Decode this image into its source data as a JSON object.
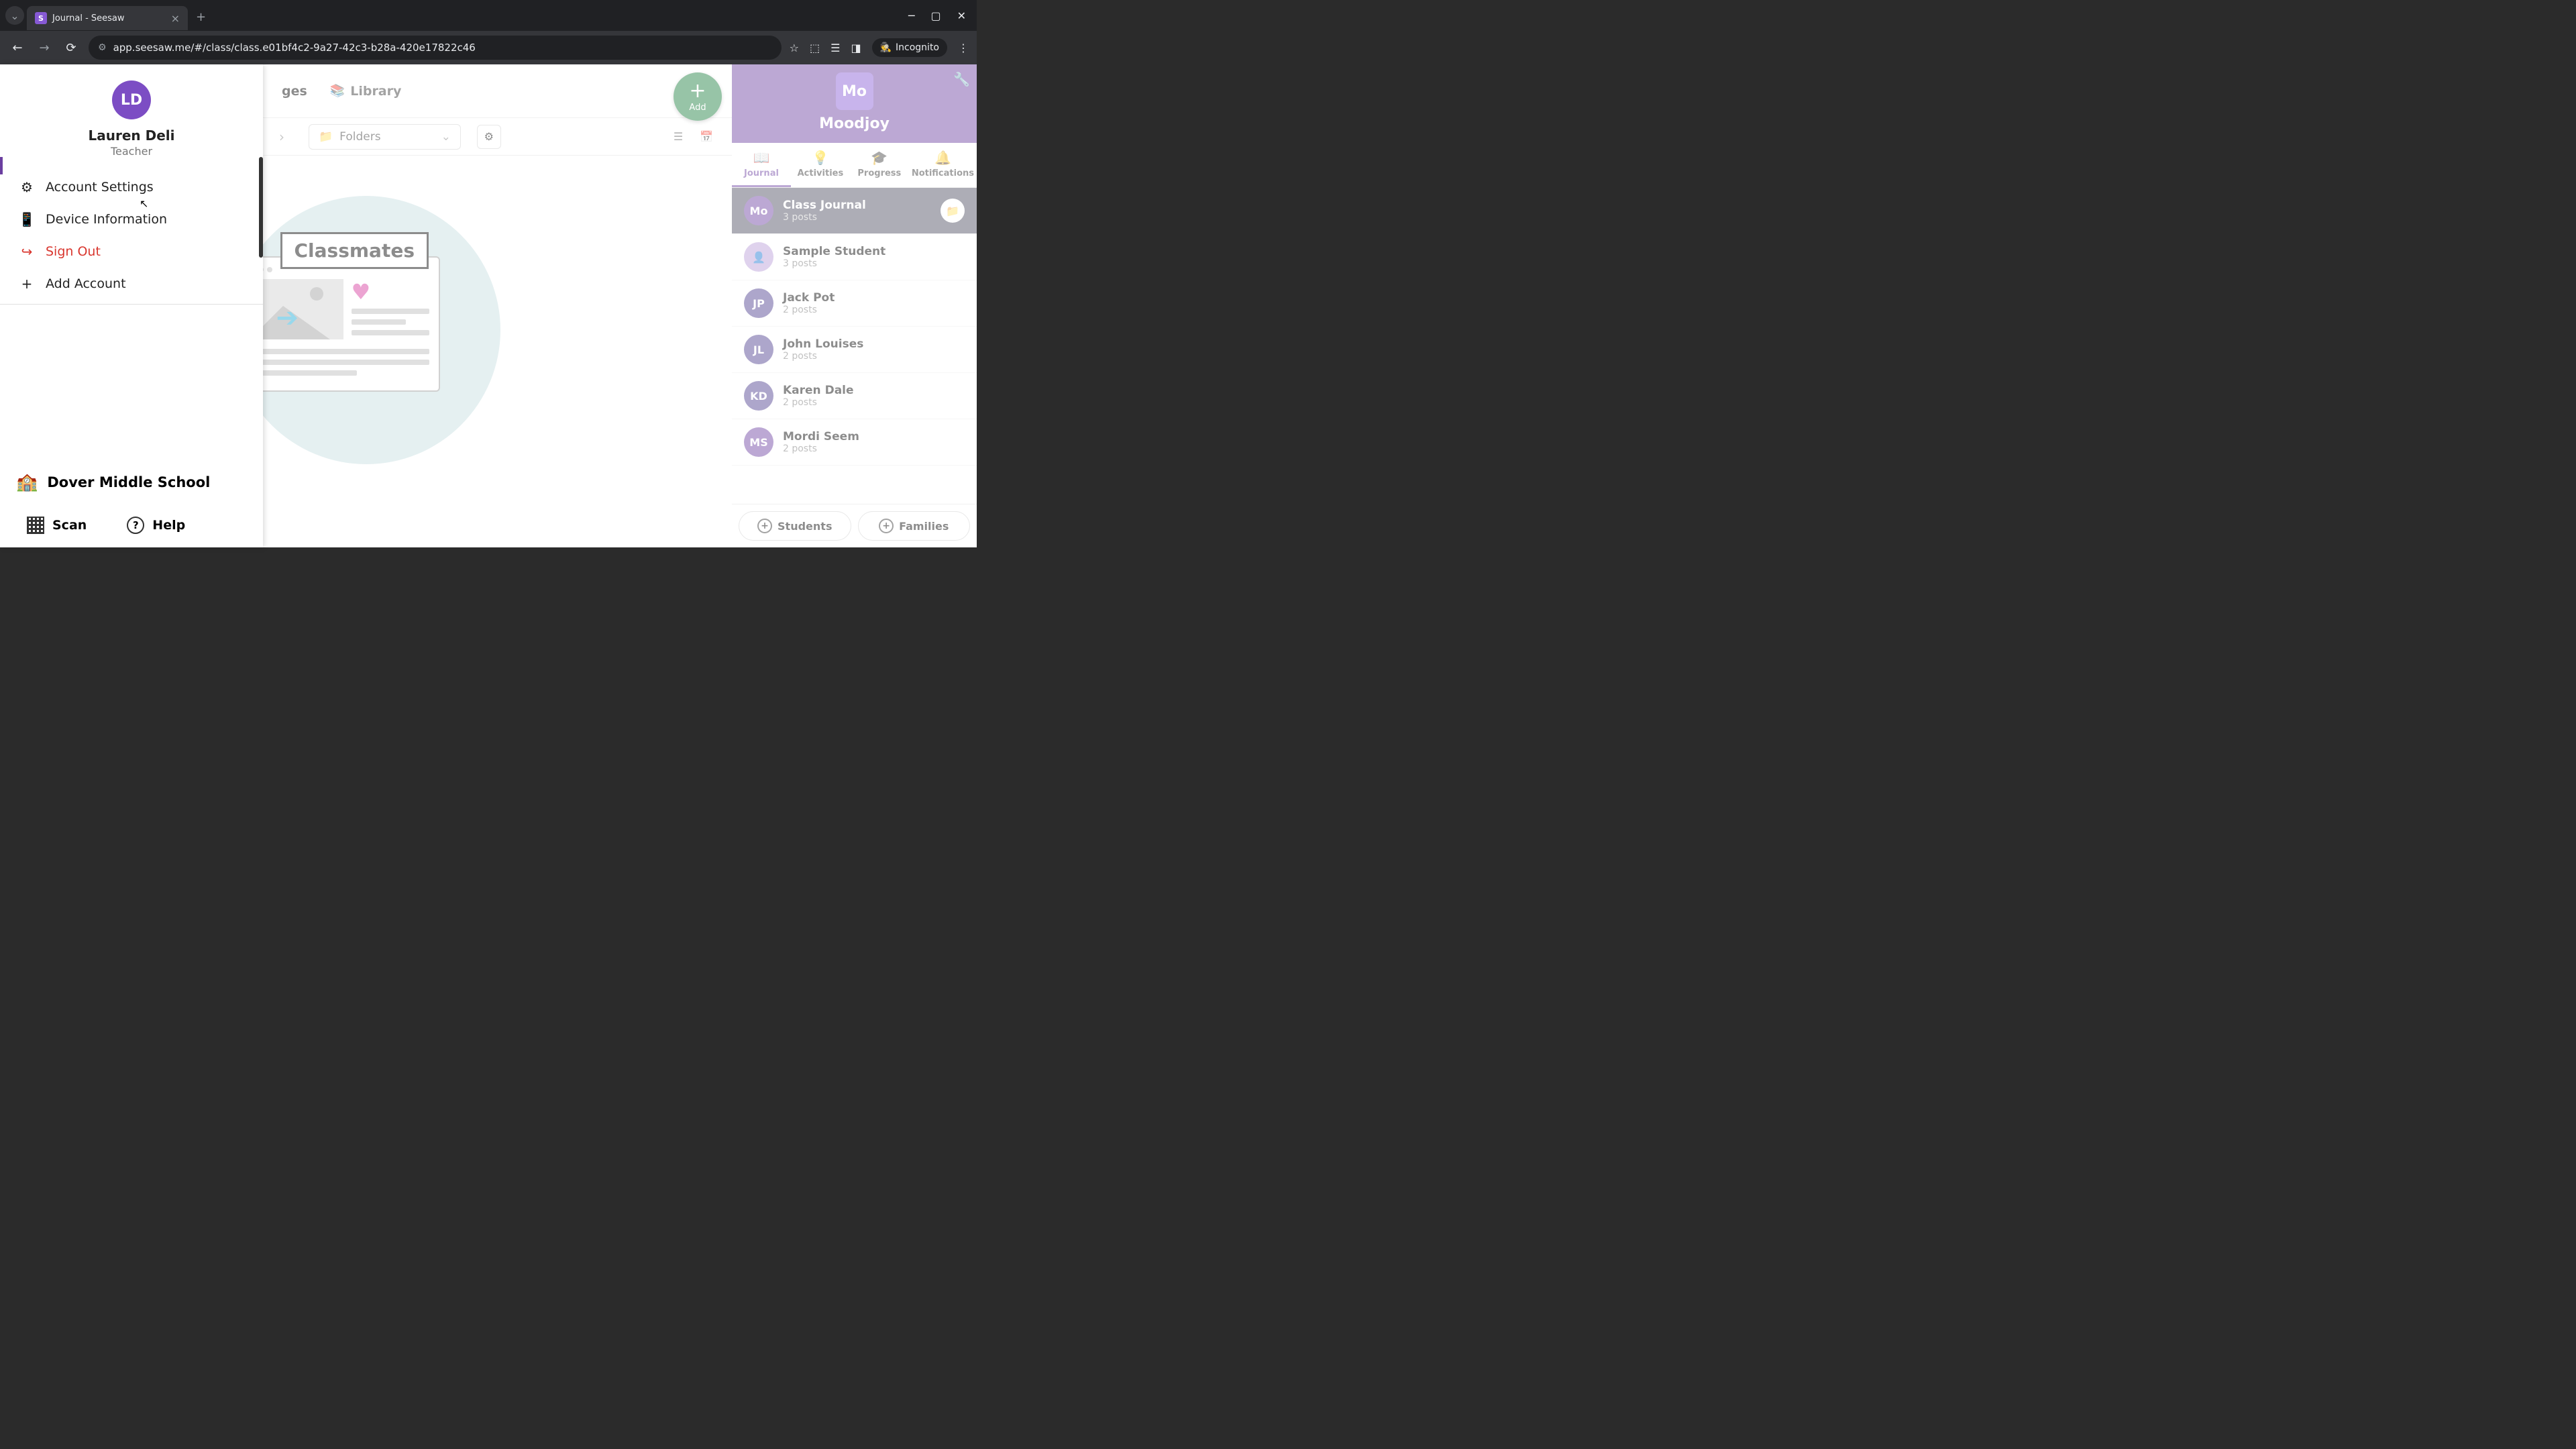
{
  "browser": {
    "tab_title": "Journal - Seesaw",
    "tab_favicon_letter": "S",
    "url": "app.seesaw.me/#/class/class.e01bf4c2-9a27-42c3-b28a-420e17822c46",
    "incognito_label": "Incognito"
  },
  "top_nav": {
    "tab_partial": "ges",
    "library_label": "Library"
  },
  "breadcrumb": {
    "folders_label": "Folders"
  },
  "add_button": {
    "label": "Add"
  },
  "class_header": {
    "avatar_text": "Mo",
    "name": "Moodjoy"
  },
  "class_tabs": [
    {
      "icon": "📖",
      "label": "Journal",
      "active": true
    },
    {
      "icon": "💡",
      "label": "Activities",
      "active": false
    },
    {
      "icon": "🎓",
      "label": "Progress",
      "active": false
    },
    {
      "icon": "🔔",
      "label": "Notifications",
      "active": false
    }
  ],
  "students": [
    {
      "avatar_text": "Mo",
      "avatar_bg": "#6b3fa0",
      "name": "Class Journal",
      "posts": "3 posts",
      "active": true,
      "has_folder": true
    },
    {
      "avatar_text": "",
      "avatar_bg": "#b89bd8",
      "avatar_icon": "👤",
      "name": "Sample Student",
      "posts": "3 posts",
      "active": false
    },
    {
      "avatar_text": "JP",
      "avatar_bg": "#4a3a8c",
      "name": "Jack Pot",
      "posts": "2 posts",
      "active": false
    },
    {
      "avatar_text": "JL",
      "avatar_bg": "#4a3a8c",
      "name": "John Louises",
      "posts": "2 posts",
      "active": false
    },
    {
      "avatar_text": "KD",
      "avatar_bg": "#4a3a8c",
      "name": "Karen Dale",
      "posts": "2 posts",
      "active": false
    },
    {
      "avatar_text": "MS",
      "avatar_bg": "#6b3fa0",
      "name": "Mordi Seem",
      "posts": "2 posts",
      "active": false
    }
  ],
  "sidebar_footer": {
    "students_label": "Students",
    "families_label": "Families"
  },
  "illustration": {
    "label": "Classmates"
  },
  "account_panel": {
    "avatar_text": "LD",
    "name": "Lauren Deli",
    "role": "Teacher",
    "menu": {
      "account_settings": "Account Settings",
      "device_info": "Device Information",
      "sign_out": "Sign Out",
      "add_account": "Add Account"
    },
    "school": "Dover Middle School",
    "scan_label": "Scan",
    "help_label": "Help"
  }
}
